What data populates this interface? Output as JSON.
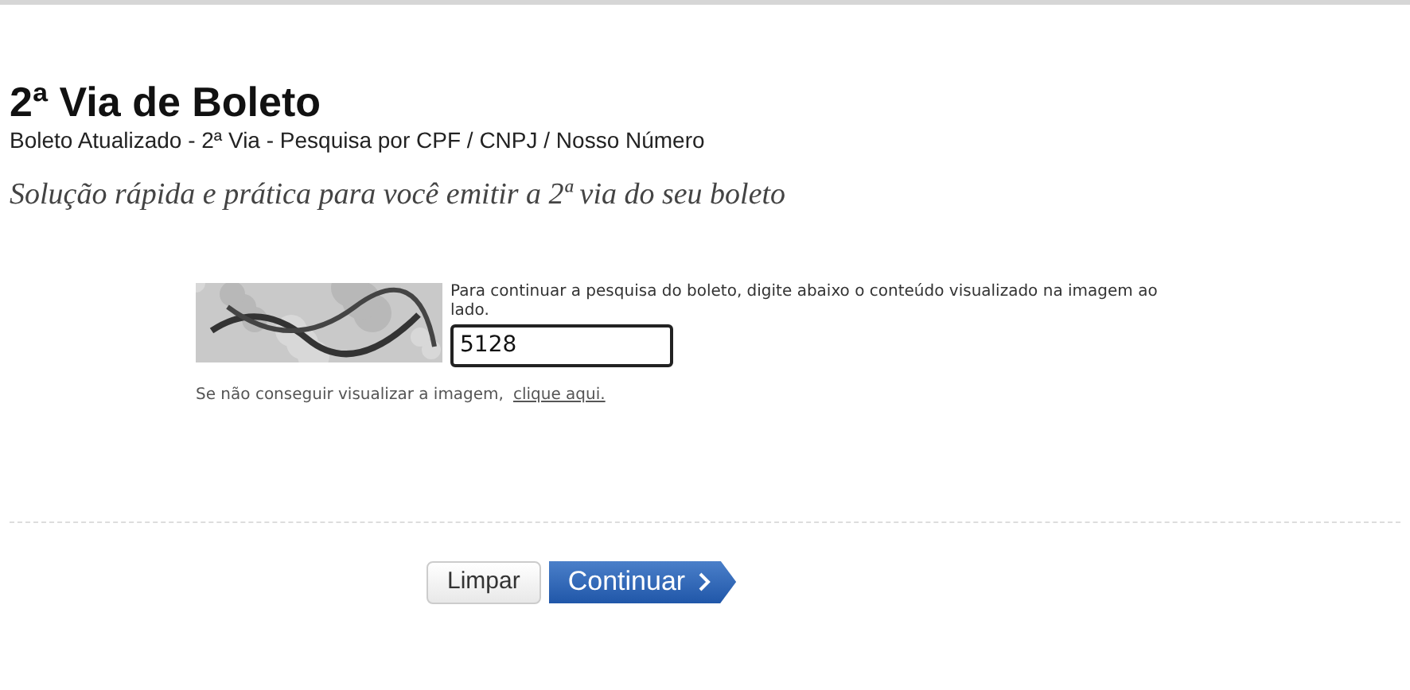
{
  "header": {
    "title": "2ª Via de Boleto",
    "subtitle": "Boleto Atualizado - 2ª Via - Pesquisa por CPF / CNPJ / Nosso Número",
    "tagline": "Solução rápida e prática para você emitir a 2ª via do seu boleto"
  },
  "captcha": {
    "instructions": "Para continuar a pesquisa do boleto, digite abaixo o conteúdo visualizado na imagem ao lado.",
    "value": "5128",
    "help_text": "Se não conseguir visualizar a imagem,",
    "help_link": "clique aqui."
  },
  "buttons": [
    {
      "label": "Limpar",
      "kind": "secondary"
    },
    {
      "label": "Continuar",
      "kind": "primary"
    }
  ]
}
